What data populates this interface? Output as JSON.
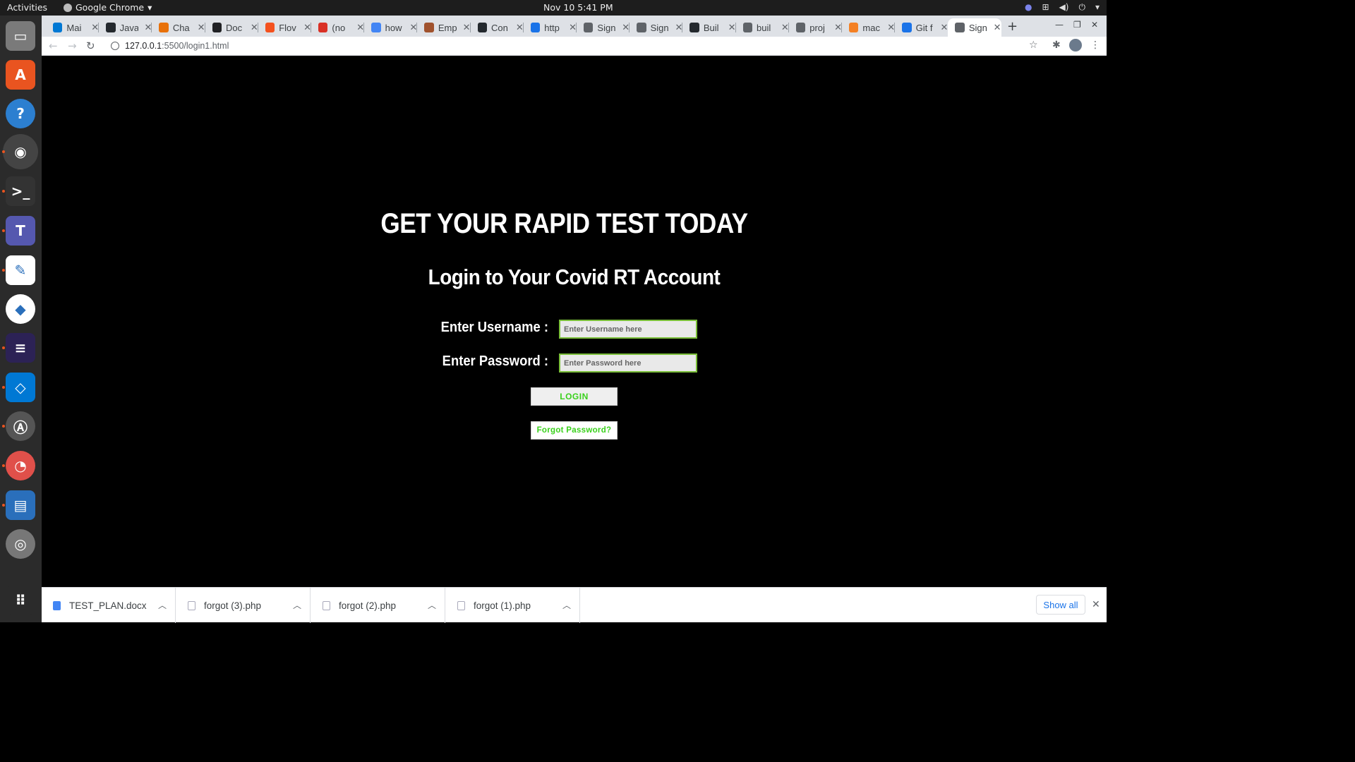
{
  "topbar": {
    "activities": "Activities",
    "app_name": "Google Chrome",
    "clock": "Nov 10  5:41 PM"
  },
  "dock": {
    "items": [
      {
        "name": "files",
        "icon": "files-icon",
        "color": "#7a7a7a"
      },
      {
        "name": "software",
        "icon": "software-icon",
        "color": "#e95420"
      },
      {
        "name": "help",
        "icon": "help-icon",
        "color": "#2c7fd0"
      },
      {
        "name": "chrome",
        "icon": "chrome-icon",
        "color": "#4285f4"
      },
      {
        "name": "terminal",
        "icon": "terminal-icon",
        "color": "#333333"
      },
      {
        "name": "teams",
        "icon": "teams-icon",
        "color": "#5558af"
      },
      {
        "name": "text-editor",
        "icon": "text-editor-icon",
        "color": "#ffffff"
      },
      {
        "name": "android-studio",
        "icon": "android-studio-icon",
        "color": "#ffffff"
      },
      {
        "name": "eclipse",
        "icon": "eclipse-icon",
        "color": "#2c2255"
      },
      {
        "name": "vscode",
        "icon": "vscode-icon",
        "color": "#0078d4"
      },
      {
        "name": "app-store",
        "icon": "app-store-icon",
        "color": "#555555"
      },
      {
        "name": "pie-app",
        "icon": "pie-app-icon",
        "color": "#e0504a"
      },
      {
        "name": "writer",
        "icon": "writer-icon",
        "color": "#2a6fbb"
      },
      {
        "name": "disc",
        "icon": "disc-icon",
        "color": "#777777"
      },
      {
        "name": "app-grid",
        "icon": "app-grid-icon",
        "color": "#2b2b2b"
      }
    ]
  },
  "tabs": [
    {
      "title": "Mai",
      "color": "#0078d4"
    },
    {
      "title": "Java",
      "color": "#24292e"
    },
    {
      "title": "Cha",
      "color": "#e8710a"
    },
    {
      "title": "Doc",
      "color": "#202124"
    },
    {
      "title": "Flov",
      "color": "#f4511e"
    },
    {
      "title": "(no",
      "color": "#d93025"
    },
    {
      "title": "how",
      "color": "#4285f4"
    },
    {
      "title": "Emp",
      "color": "#a0522d"
    },
    {
      "title": "Con",
      "color": "#24292e"
    },
    {
      "title": "http",
      "color": "#1a73e8"
    },
    {
      "title": "Sign",
      "color": "#5f6368"
    },
    {
      "title": "Sign",
      "color": "#5f6368"
    },
    {
      "title": "Buil",
      "color": "#24292e"
    },
    {
      "title": "buil",
      "color": "#5f6368"
    },
    {
      "title": "proj",
      "color": "#5f6368"
    },
    {
      "title": "mac",
      "color": "#f48024"
    },
    {
      "title": "Git f",
      "color": "#1a73e8"
    },
    {
      "title": "Sign",
      "color": "#5f6368"
    }
  ],
  "url": {
    "host": "127.0.0.1",
    "path": ":5500/login1.html"
  },
  "page": {
    "title": "GET YOUR RAPID TEST TODAY",
    "subtitle": "Login to Your Covid RT Account",
    "username_label": "Enter Username :",
    "username_placeholder": "Enter Username here",
    "password_label": "Enter Password :",
    "password_placeholder": "Enter Password here",
    "login_button": "LOGIN",
    "forgot_button": "Forgot Password?"
  },
  "downloads": {
    "items": [
      "TEST_PLAN.docx",
      "forgot (3).php",
      "forgot (2).php",
      "forgot (1).php"
    ],
    "show_all": "Show all"
  }
}
